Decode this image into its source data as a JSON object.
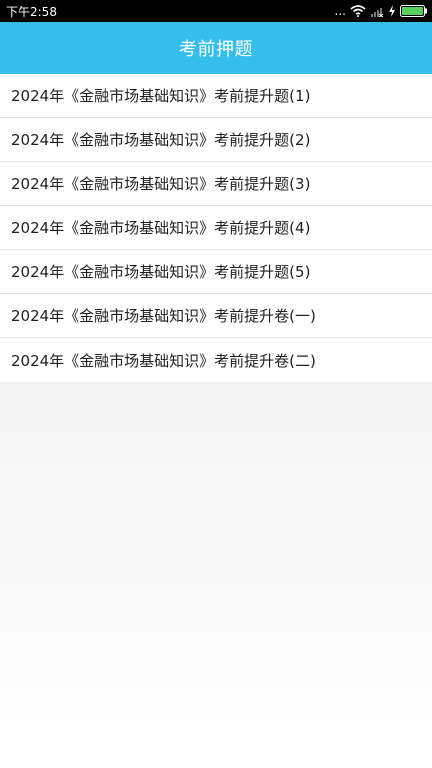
{
  "status_bar": {
    "time": "下午2:58",
    "more_dots": "...",
    "icons": [
      "wifi-icon",
      "signal-icon",
      "charging-icon",
      "battery-icon"
    ],
    "colors": {
      "battery": "#59d15a"
    }
  },
  "header": {
    "title": "考前押题",
    "background": "#35bdeb"
  },
  "list": {
    "items": [
      {
        "label": "2024年《金融市场基础知识》考前提升题(1)"
      },
      {
        "label": "2024年《金融市场基础知识》考前提升题(2)"
      },
      {
        "label": "2024年《金融市场基础知识》考前提升题(3)"
      },
      {
        "label": "2024年《金融市场基础知识》考前提升题(4)"
      },
      {
        "label": "2024年《金融市场基础知识》考前提升题(5)"
      },
      {
        "label": "2024年《金融市场基础知识》考前提升卷(一)"
      },
      {
        "label": "2024年《金融市场基础知识》考前提升卷(二)"
      }
    ]
  }
}
